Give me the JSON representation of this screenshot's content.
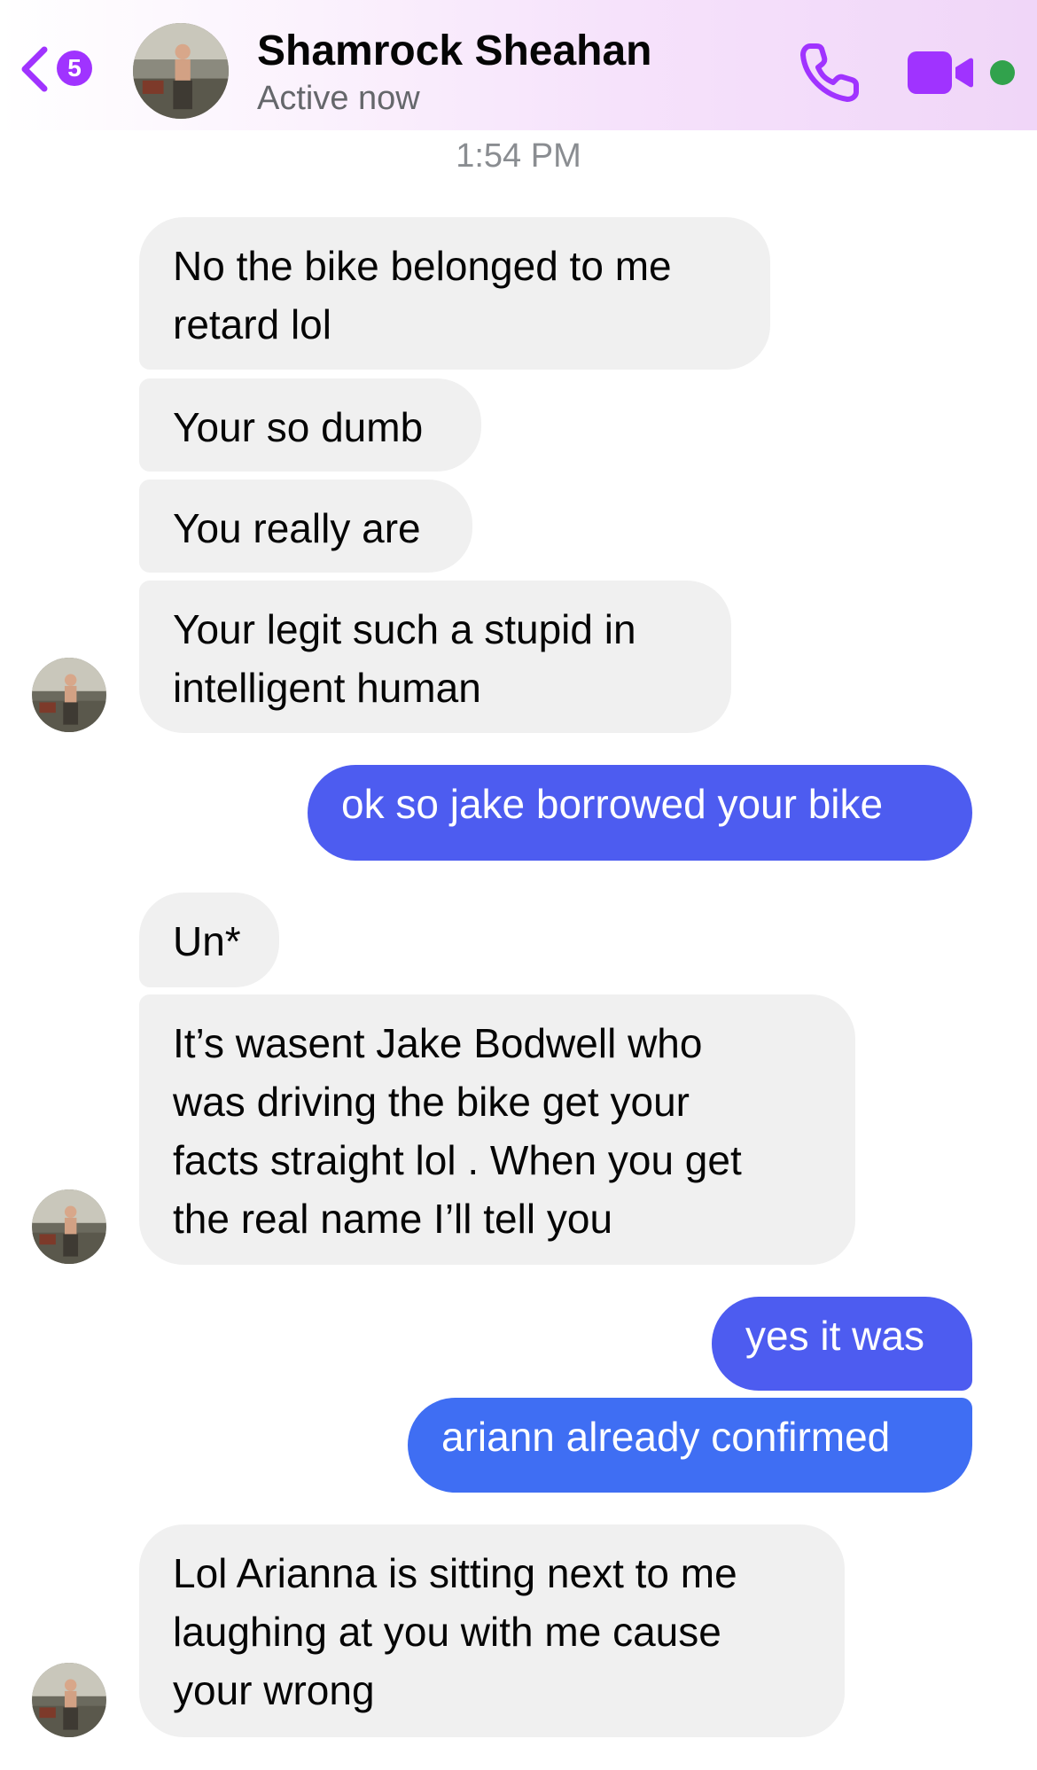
{
  "header": {
    "back_count": "5",
    "name": "Shamrock Sheahan",
    "status": "Active now",
    "accent": "#a033ff",
    "online_color": "#31a24c",
    "icons": [
      "chevron-left-icon",
      "phone-icon",
      "video-camera-icon"
    ]
  },
  "timestamp": "1:54 PM",
  "messages": [
    {
      "from": "them",
      "lines": [
        "No the bike belonged to me",
        "retard lol"
      ]
    },
    {
      "from": "them",
      "lines": [
        "Your so dumb"
      ]
    },
    {
      "from": "them",
      "lines": [
        "You really are"
      ]
    },
    {
      "from": "them",
      "lines": [
        "Your legit such a stupid in",
        "intelligent human"
      ]
    },
    {
      "from": "me",
      "lines": [
        "ok so jake borrowed your bike"
      ]
    },
    {
      "from": "them",
      "lines": [
        "Un*"
      ]
    },
    {
      "from": "them",
      "lines": [
        "It’s wasent  Jake Bodwell who",
        "was driving the bike get your",
        "facts straight lol . When you get",
        "the real name I’ll tell you"
      ]
    },
    {
      "from": "me",
      "lines": [
        "yes it was"
      ]
    },
    {
      "from": "me",
      "lines": [
        "ariann already confirmed"
      ]
    },
    {
      "from": "them",
      "lines": [
        "Lol Arianna is sitting next to me",
        "laughing at you with me cause",
        "your wrong"
      ]
    }
  ],
  "colors": {
    "incoming_bubble": "#f0f0f0",
    "outgoing_bubble_top": "#4d5cf0",
    "outgoing_bubble_bottom": "#3f6ef3"
  }
}
